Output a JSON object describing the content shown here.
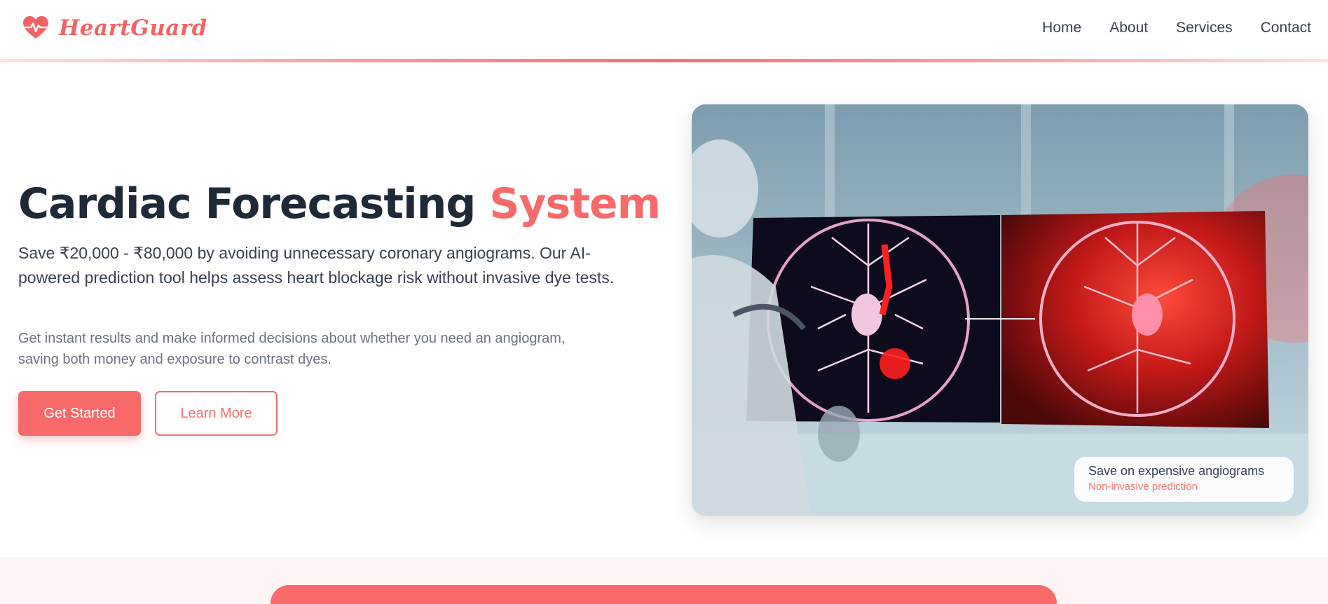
{
  "brand": {
    "name": "HeartGuard",
    "icon": "heart-pulse-icon",
    "color": "#f26464"
  },
  "nav": [
    {
      "label": "Home"
    },
    {
      "label": "About"
    },
    {
      "label": "Services"
    },
    {
      "label": "Contact"
    }
  ],
  "hero": {
    "title_main": "Cardiac Forecasting",
    "title_accent": "System",
    "description": "Save ₹20,000 - ₹80,000 by avoiding unnecessary coronary angiograms. Our AI-powered prediction tool helps assess heart blockage risk without invasive dye tests.",
    "subtext": "Get instant results and make informed decisions about whether you need an angiogram, saving both money and exposure to contrast dyes.",
    "primary_button": "Get Started",
    "secondary_button": "Learn More"
  },
  "image_badge": {
    "title": "Save on expensive angiograms",
    "subtitle": "Non-invasive prediction"
  },
  "colors": {
    "accent": "#f86a6a",
    "text": "#1f2937",
    "muted": "#6b7280"
  }
}
